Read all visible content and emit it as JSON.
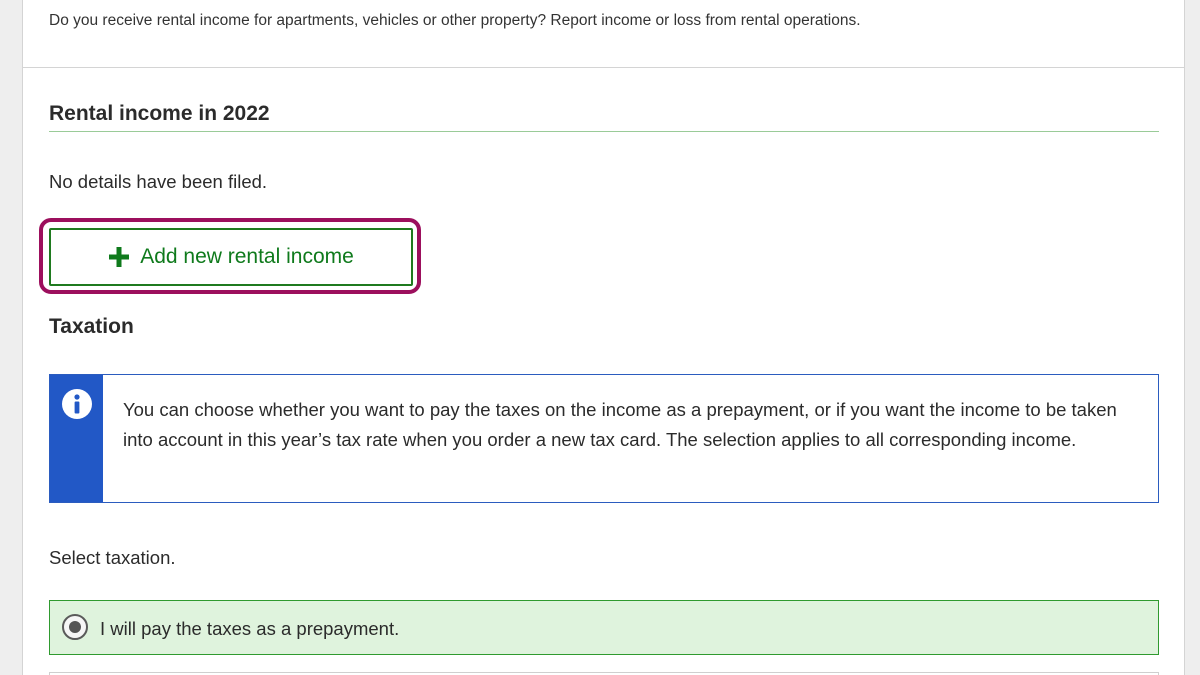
{
  "intro": {
    "text": "Do you receive rental income for apartments, vehicles or other property? Report income or loss from rental operations."
  },
  "rental": {
    "title": "Rental income in 2022",
    "no_details": "No details have been filed.",
    "add_button_label": "Add new rental income",
    "add_icon": "plus-icon"
  },
  "taxation": {
    "title": "Taxation",
    "info_icon": "info-icon",
    "info_text": "You can choose whether you want to pay the taxes on the income as a prepayment, or if you want the income to be taken into account in this year’s tax rate when you order a new tax card. The selection applies to all corresponding income.",
    "select_label": "Select taxation.",
    "options": [
      {
        "label": "I will pay the taxes as a prepayment.",
        "selected": true
      }
    ]
  },
  "colors": {
    "accent_green": "#0f7a1c",
    "highlight_frame": "#9c0f5d",
    "info_blue": "#2258c6",
    "selected_bg": "#dff3dd"
  }
}
